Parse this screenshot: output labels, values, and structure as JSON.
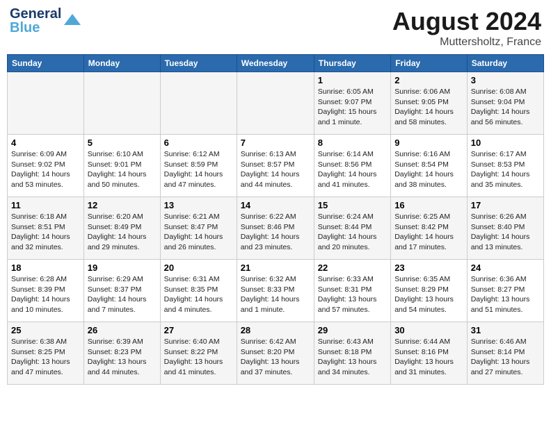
{
  "header": {
    "logo_general": "General",
    "logo_blue": "Blue",
    "month_year": "August 2024",
    "location": "Muttersholtz, France"
  },
  "days_of_week": [
    "Sunday",
    "Monday",
    "Tuesday",
    "Wednesday",
    "Thursday",
    "Friday",
    "Saturday"
  ],
  "weeks": [
    [
      {
        "day": "",
        "info": ""
      },
      {
        "day": "",
        "info": ""
      },
      {
        "day": "",
        "info": ""
      },
      {
        "day": "",
        "info": ""
      },
      {
        "day": "1",
        "info": "Sunrise: 6:05 AM\nSunset: 9:07 PM\nDaylight: 15 hours and 1 minute."
      },
      {
        "day": "2",
        "info": "Sunrise: 6:06 AM\nSunset: 9:05 PM\nDaylight: 14 hours and 58 minutes."
      },
      {
        "day": "3",
        "info": "Sunrise: 6:08 AM\nSunset: 9:04 PM\nDaylight: 14 hours and 56 minutes."
      }
    ],
    [
      {
        "day": "4",
        "info": "Sunrise: 6:09 AM\nSunset: 9:02 PM\nDaylight: 14 hours and 53 minutes."
      },
      {
        "day": "5",
        "info": "Sunrise: 6:10 AM\nSunset: 9:01 PM\nDaylight: 14 hours and 50 minutes."
      },
      {
        "day": "6",
        "info": "Sunrise: 6:12 AM\nSunset: 8:59 PM\nDaylight: 14 hours and 47 minutes."
      },
      {
        "day": "7",
        "info": "Sunrise: 6:13 AM\nSunset: 8:57 PM\nDaylight: 14 hours and 44 minutes."
      },
      {
        "day": "8",
        "info": "Sunrise: 6:14 AM\nSunset: 8:56 PM\nDaylight: 14 hours and 41 minutes."
      },
      {
        "day": "9",
        "info": "Sunrise: 6:16 AM\nSunset: 8:54 PM\nDaylight: 14 hours and 38 minutes."
      },
      {
        "day": "10",
        "info": "Sunrise: 6:17 AM\nSunset: 8:53 PM\nDaylight: 14 hours and 35 minutes."
      }
    ],
    [
      {
        "day": "11",
        "info": "Sunrise: 6:18 AM\nSunset: 8:51 PM\nDaylight: 14 hours and 32 minutes."
      },
      {
        "day": "12",
        "info": "Sunrise: 6:20 AM\nSunset: 8:49 PM\nDaylight: 14 hours and 29 minutes."
      },
      {
        "day": "13",
        "info": "Sunrise: 6:21 AM\nSunset: 8:47 PM\nDaylight: 14 hours and 26 minutes."
      },
      {
        "day": "14",
        "info": "Sunrise: 6:22 AM\nSunset: 8:46 PM\nDaylight: 14 hours and 23 minutes."
      },
      {
        "day": "15",
        "info": "Sunrise: 6:24 AM\nSunset: 8:44 PM\nDaylight: 14 hours and 20 minutes."
      },
      {
        "day": "16",
        "info": "Sunrise: 6:25 AM\nSunset: 8:42 PM\nDaylight: 14 hours and 17 minutes."
      },
      {
        "day": "17",
        "info": "Sunrise: 6:26 AM\nSunset: 8:40 PM\nDaylight: 14 hours and 13 minutes."
      }
    ],
    [
      {
        "day": "18",
        "info": "Sunrise: 6:28 AM\nSunset: 8:39 PM\nDaylight: 14 hours and 10 minutes."
      },
      {
        "day": "19",
        "info": "Sunrise: 6:29 AM\nSunset: 8:37 PM\nDaylight: 14 hours and 7 minutes."
      },
      {
        "day": "20",
        "info": "Sunrise: 6:31 AM\nSunset: 8:35 PM\nDaylight: 14 hours and 4 minutes."
      },
      {
        "day": "21",
        "info": "Sunrise: 6:32 AM\nSunset: 8:33 PM\nDaylight: 14 hours and 1 minute."
      },
      {
        "day": "22",
        "info": "Sunrise: 6:33 AM\nSunset: 8:31 PM\nDaylight: 13 hours and 57 minutes."
      },
      {
        "day": "23",
        "info": "Sunrise: 6:35 AM\nSunset: 8:29 PM\nDaylight: 13 hours and 54 minutes."
      },
      {
        "day": "24",
        "info": "Sunrise: 6:36 AM\nSunset: 8:27 PM\nDaylight: 13 hours and 51 minutes."
      }
    ],
    [
      {
        "day": "25",
        "info": "Sunrise: 6:38 AM\nSunset: 8:25 PM\nDaylight: 13 hours and 47 minutes."
      },
      {
        "day": "26",
        "info": "Sunrise: 6:39 AM\nSunset: 8:23 PM\nDaylight: 13 hours and 44 minutes."
      },
      {
        "day": "27",
        "info": "Sunrise: 6:40 AM\nSunset: 8:22 PM\nDaylight: 13 hours and 41 minutes."
      },
      {
        "day": "28",
        "info": "Sunrise: 6:42 AM\nSunset: 8:20 PM\nDaylight: 13 hours and 37 minutes."
      },
      {
        "day": "29",
        "info": "Sunrise: 6:43 AM\nSunset: 8:18 PM\nDaylight: 13 hours and 34 minutes."
      },
      {
        "day": "30",
        "info": "Sunrise: 6:44 AM\nSunset: 8:16 PM\nDaylight: 13 hours and 31 minutes."
      },
      {
        "day": "31",
        "info": "Sunrise: 6:46 AM\nSunset: 8:14 PM\nDaylight: 13 hours and 27 minutes."
      }
    ]
  ]
}
